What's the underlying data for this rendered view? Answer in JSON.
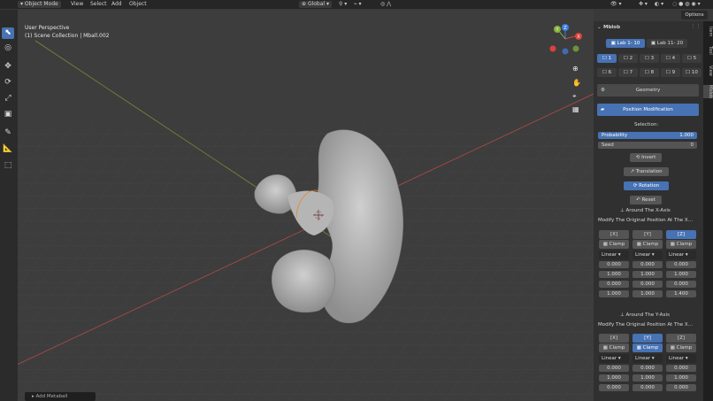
{
  "header": {
    "mode": "Object Mode",
    "menus": [
      "View",
      "Select",
      "Add",
      "Object"
    ],
    "orientation": "Global",
    "options": "Options"
  },
  "viewport": {
    "title": "User Perspective",
    "collection": "(1) Scene Collection | Mball.002",
    "gizmo": {
      "x": "X",
      "y": "Y",
      "z": "Z"
    }
  },
  "panel": {
    "title": "Mblob",
    "tabs": [
      "Lab 1- 10",
      "Lab 11- 20"
    ],
    "labs_row1": [
      "1",
      "2",
      "3",
      "4",
      "5"
    ],
    "labs_row2": [
      "6",
      "7",
      "8",
      "9",
      "10"
    ],
    "geometry": "Geometry",
    "position_mod": "Position Modification",
    "selection_label": "Selection:",
    "probability_label": "Probability",
    "probability_value": "1.000",
    "seed_label": "Seed",
    "seed_value": "0",
    "invert": "Invert",
    "translation": "Translation",
    "rotation": "Rotation",
    "reset": "Reset",
    "x_axis": {
      "header": "Around The X-Axis",
      "desc": "Modify The Original Position At The X...",
      "axes": [
        "X",
        "Y",
        "Z"
      ],
      "clamp": "Clamp",
      "mode": "Linear",
      "rows": [
        [
          "0.000",
          "0.000",
          "0.000"
        ],
        [
          "1.000",
          "1.000",
          "1.000"
        ],
        [
          "0.000",
          "0.000",
          "0.000"
        ],
        [
          "1.000",
          "1.000",
          "1.400"
        ]
      ]
    },
    "y_axis": {
      "header": "Around The Y-Axis",
      "desc": "Modify The Original Position At The X...",
      "axes": [
        "X",
        "Y",
        "Z"
      ],
      "clamp": "Clamp",
      "mode": "Linear",
      "rows": [
        [
          "0.000",
          "0.000",
          "0.000"
        ],
        [
          "1.000",
          "1.000",
          "1.000"
        ],
        [
          "0.000",
          "0.000",
          "0.000"
        ]
      ]
    }
  },
  "side_tabs": [
    "Item",
    "Tool",
    "View",
    "Mblob"
  ],
  "status": "Add Metaball",
  "colors": {
    "accent": "#4772b3",
    "x_axis": "#d9433b",
    "y_axis": "#86b33a",
    "z_axis": "#3d7fe0"
  }
}
